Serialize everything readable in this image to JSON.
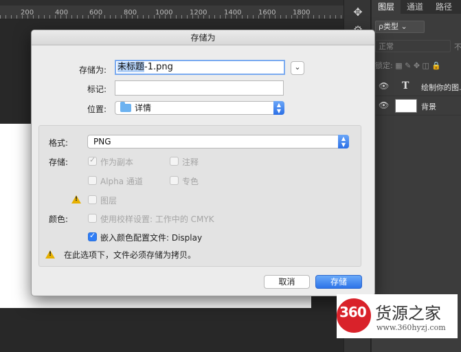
{
  "ruler": {
    "labels": [
      "200",
      "400",
      "600",
      "800",
      "1000",
      "1200",
      "1400",
      "1600",
      "1800"
    ]
  },
  "panel": {
    "tabs": [
      "图层",
      "通道",
      "路径"
    ],
    "kind_filter": "ρ类型",
    "blend_mode": "正常",
    "opacity_fragment": "不",
    "lock_label": "锁定:",
    "layers": [
      {
        "type_glyph": "T",
        "name": "绘制你的图..."
      },
      {
        "name": "背景"
      }
    ]
  },
  "dialog": {
    "title": "存储为",
    "save_as_label": "存储为:",
    "filename_selected": "未标题",
    "filename_rest": "-1.png",
    "tags_label": "标记:",
    "tags_value": "",
    "location_label": "位置:",
    "location_value": "详情",
    "format_label": "格式:",
    "format_value": "PNG",
    "save_label": "存储:",
    "as_copy": "作为副本",
    "notes": "注释",
    "alpha_channels": "Alpha 通道",
    "spot_colors": "专色",
    "layers": "图层",
    "color_label": "颜色:",
    "use_proof_setup": "使用校样设置: 工作中的 CMYK",
    "embed_profile": "嵌入颜色配置文件: Display",
    "warning": "在此选项下，文件必须存储为拷贝。",
    "cancel_button": "取消",
    "save_button": "存储"
  },
  "watermark": {
    "logo": "360",
    "name": "货源之家",
    "url": "www.360hyzj.com"
  },
  "colors": {
    "accent": "#2f7df6",
    "warning": "#e6b000",
    "logo_red": "#d9222a"
  }
}
